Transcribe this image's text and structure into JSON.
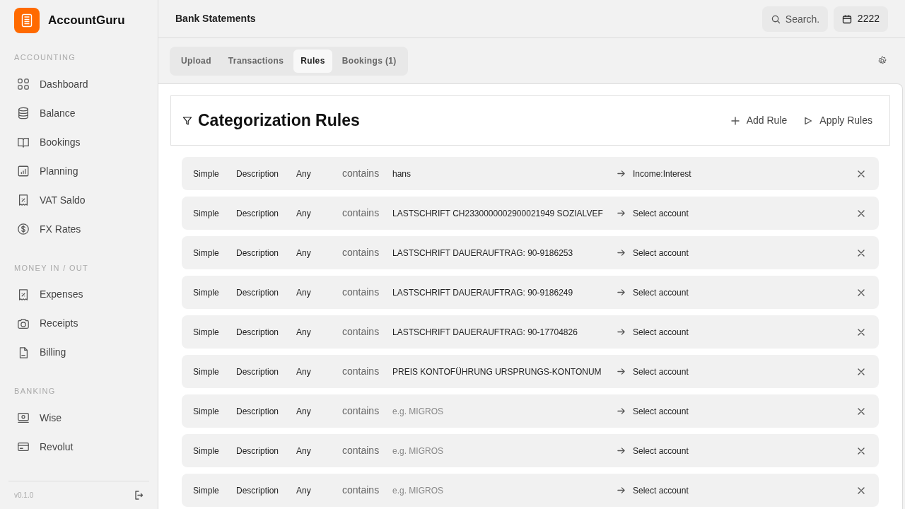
{
  "app": {
    "name": "AccountGuru",
    "version": "v0.1.0"
  },
  "sidebar": {
    "sections": [
      {
        "title": "ACCOUNTING",
        "items": [
          {
            "label": "Dashboard"
          },
          {
            "label": "Balance"
          },
          {
            "label": "Bookings"
          },
          {
            "label": "Planning"
          },
          {
            "label": "VAT Saldo"
          },
          {
            "label": "FX Rates"
          }
        ]
      },
      {
        "title": "MONEY IN / OUT",
        "items": [
          {
            "label": "Expenses"
          },
          {
            "label": "Receipts"
          },
          {
            "label": "Billing"
          }
        ]
      },
      {
        "title": "BANKING",
        "items": [
          {
            "label": "Wise"
          },
          {
            "label": "Revolut"
          }
        ]
      }
    ]
  },
  "header": {
    "title": "Bank Statements",
    "search": {
      "placeholder": "Search."
    },
    "year": "2222"
  },
  "tabs": [
    {
      "label": "Upload",
      "selected": false
    },
    {
      "label": "Transactions",
      "selected": false
    },
    {
      "label": "Rules",
      "selected": true
    },
    {
      "label": "Bookings (1)",
      "selected": false
    }
  ],
  "rules_panel": {
    "title": "Categorization Rules",
    "actions": [
      "Add Rule",
      "Apply Rules"
    ],
    "rules": [
      {
        "type": "Simple",
        "field": "Description",
        "match": "Any",
        "operator": "contains",
        "pattern": {
          "value": "hans"
        },
        "account": {
          "value": "Income:Interest"
        }
      },
      {
        "type": "Simple",
        "field": "Description",
        "match": "Any",
        "operator": "contains",
        "pattern": {
          "value": "LASTSCHRIFT CH2330000002900021949 SOZIALVEF"
        },
        "account": {
          "placeholder": "Select account"
        }
      },
      {
        "type": "Simple",
        "field": "Description",
        "match": "Any",
        "operator": "contains",
        "pattern": {
          "value": "LASTSCHRIFT DAUERAUFTRAG: 90-9186253"
        },
        "account": {
          "placeholder": "Select account"
        }
      },
      {
        "type": "Simple",
        "field": "Description",
        "match": "Any",
        "operator": "contains",
        "pattern": {
          "value": "LASTSCHRIFT DAUERAUFTRAG: 90-9186249"
        },
        "account": {
          "placeholder": "Select account"
        }
      },
      {
        "type": "Simple",
        "field": "Description",
        "match": "Any",
        "operator": "contains",
        "pattern": {
          "value": "LASTSCHRIFT DAUERAUFTRAG: 90-17704826"
        },
        "account": {
          "placeholder": "Select account"
        }
      },
      {
        "type": "Simple",
        "field": "Description",
        "match": "Any",
        "operator": "contains",
        "pattern": {
          "value": "PREIS KONTOFÜHRUNG URSPRUNGS-KONTONUM"
        },
        "account": {
          "placeholder": "Select account"
        }
      },
      {
        "type": "Simple",
        "field": "Description",
        "match": "Any",
        "operator": "contains",
        "pattern": {
          "placeholder": "e.g. MIGROS"
        },
        "account": {
          "placeholder": "Select account"
        }
      },
      {
        "type": "Simple",
        "field": "Description",
        "match": "Any",
        "operator": "contains",
        "pattern": {
          "placeholder": "e.g. MIGROS"
        },
        "account": {
          "placeholder": "Select account"
        }
      },
      {
        "type": "Simple",
        "field": "Description",
        "match": "Any",
        "operator": "contains",
        "pattern": {
          "placeholder": "e.g. MIGROS"
        },
        "account": {
          "placeholder": "Select account"
        }
      }
    ]
  }
}
